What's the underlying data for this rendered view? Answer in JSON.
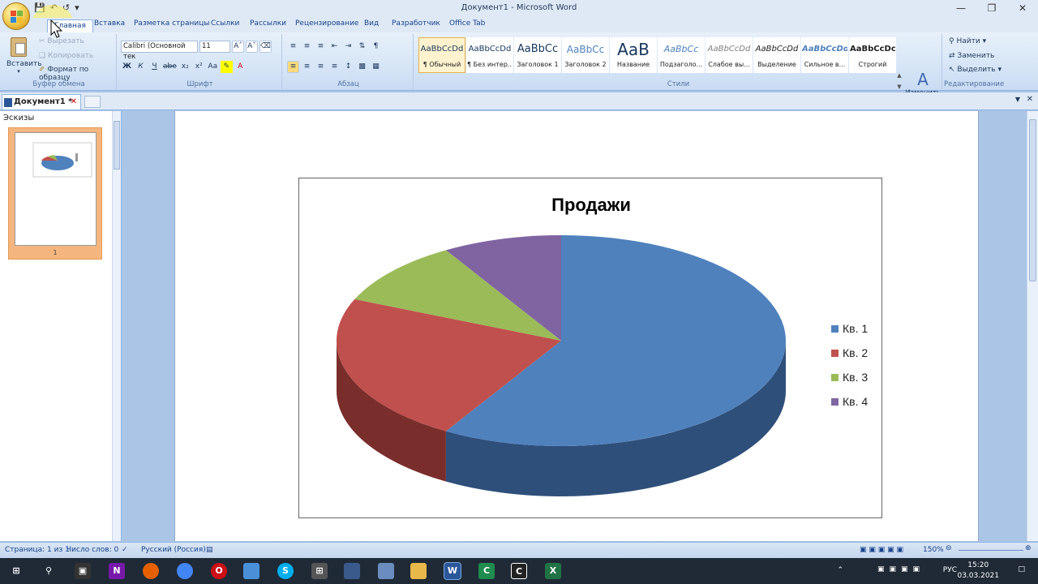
{
  "window": {
    "title": "Документ1 - Microsoft Word"
  },
  "tabs": [
    "Главная",
    "Вставка",
    "Разметка страницы",
    "Ссылки",
    "Рассылки",
    "Рецензирование",
    "Вид",
    "Разработчик",
    "Office Tab"
  ],
  "clipboard": {
    "paste": "Вставить",
    "cut": "Вырезать",
    "copy": "Копировать",
    "format": "Формат по образцу",
    "label": "Буфер обмена"
  },
  "font": {
    "name": "Calibri (Основной тек",
    "size": "11",
    "label": "Шрифт"
  },
  "paragraph": {
    "label": "Абзац"
  },
  "styles": {
    "label": "Стили",
    "items": [
      {
        "sample": "AaBbCcDd",
        "name": "¶ Обычный"
      },
      {
        "sample": "AaBbCcDd",
        "name": "¶ Без интер..."
      },
      {
        "sample": "AaBbCc",
        "name": "Заголовок 1"
      },
      {
        "sample": "AaBbCc",
        "name": "Заголовок 2"
      },
      {
        "sample": "AaB",
        "name": "Название"
      },
      {
        "sample": "AaBbCc",
        "name": "Подзаголо..."
      },
      {
        "sample": "AaBbCcDd",
        "name": "Слабое вы..."
      },
      {
        "sample": "AaBbCcDd",
        "name": "Выделение"
      },
      {
        "sample": "AaBbCcDd",
        "name": "Сильное в..."
      },
      {
        "sample": "AaBbCcDc",
        "name": "Строгий"
      }
    ],
    "change": "Изменить стили"
  },
  "editing": {
    "find": "Найти",
    "replace": "Заменить",
    "select": "Выделить",
    "label": "Редактирование"
  },
  "doc_tab": "Документ1 *",
  "thumbs": {
    "title": "Эскизы",
    "page": "1"
  },
  "status": {
    "page": "Страница: 1 из 1",
    "words": "Число слов: 0",
    "lang": "Русский (Россия)",
    "zoom": "150%"
  },
  "taskbar": {
    "lang": "РУС",
    "time": "15:20",
    "date": "03.03.2021"
  },
  "colors": {
    "q1": "#4f81bd",
    "q2": "#c0504d",
    "q3": "#9bbb59",
    "q4": "#8064a2"
  },
  "chart_data": {
    "type": "pie",
    "title": "Продажи",
    "categories": [
      "Кв. 1",
      "Кв. 2",
      "Кв. 3",
      "Кв. 4"
    ],
    "values": [
      8.2,
      3.2,
      1.4,
      1.2
    ],
    "legend": "right"
  }
}
